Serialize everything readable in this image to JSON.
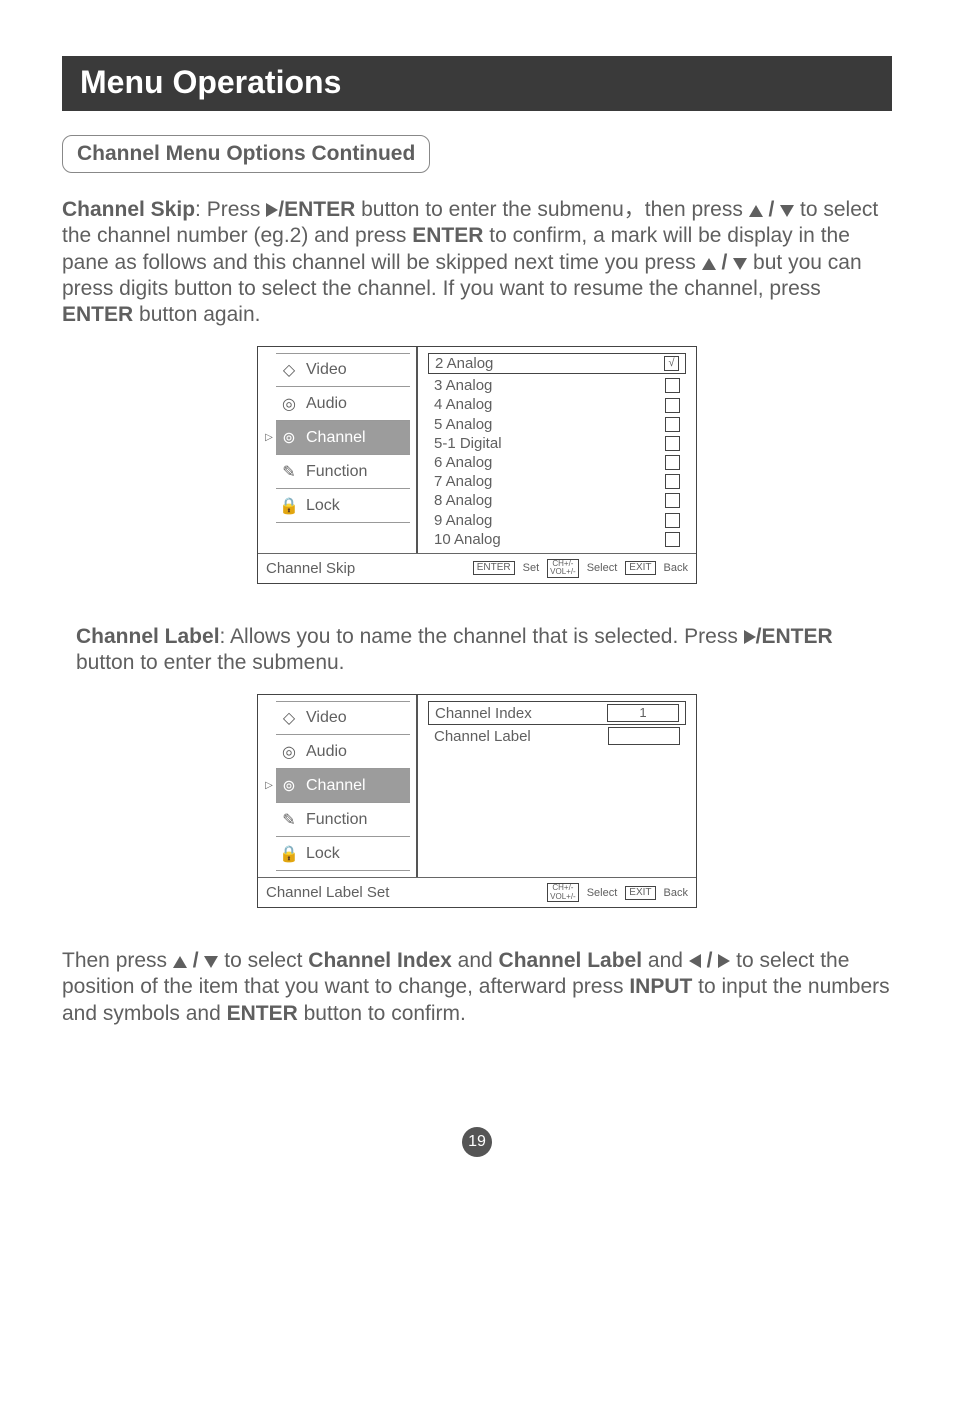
{
  "title": "Menu Operations",
  "subhead": "Channel Menu Options Continued",
  "para1": {
    "lead": "Channel Skip",
    "a": ": Press",
    "b": "/ENTER",
    "c": " button to enter the submenu，then press ",
    "sep": " / ",
    "d": " to select the channel number (eg.2) and press ",
    "enter1": "ENTER",
    "e": " to confirm, a mark will be display in the pane as follows and this channel will be skipped next time you press ",
    "f": " but you can press digits button to select the channel. If you want to resume the channel, press ",
    "enter2": "ENTER",
    "g": " button again."
  },
  "menu": {
    "items": [
      {
        "label": "Video",
        "icon": "◇"
      },
      {
        "label": "Audio",
        "icon": "◎"
      },
      {
        "label": "Channel",
        "icon": "⊚",
        "selected": true
      },
      {
        "label": "Function",
        "icon": "✎"
      },
      {
        "label": "Lock",
        "icon": "🔒"
      }
    ]
  },
  "skip_list": [
    {
      "name": "2 Analog",
      "checked": true,
      "selected": true
    },
    {
      "name": "3 Analog"
    },
    {
      "name": "4 Analog"
    },
    {
      "name": "5 Analog"
    },
    {
      "name": "5-1 Digital"
    },
    {
      "name": "6 Analog"
    },
    {
      "name": "7 Analog"
    },
    {
      "name": "8 Analog"
    },
    {
      "name": "9 Analog"
    },
    {
      "name": "10 Analog"
    }
  ],
  "footer1": {
    "name": "Channel Skip",
    "k1": "ENTER",
    "t1": "Set",
    "k2a": "CH+/-",
    "k2b": "VOL+/-",
    "t2": "Select",
    "k3": "EXIT",
    "t3": "Back"
  },
  "para2": {
    "lead": "Channel Label",
    "a": ": Allows you to name the channel that is selected. Press ",
    "b": "/ENTER",
    "c": " button to enter the submenu."
  },
  "label_panel": {
    "rows": [
      {
        "name": "Channel Index",
        "value": "1",
        "selected": true
      },
      {
        "name": "Channel Label",
        "value": ""
      }
    ]
  },
  "footer2": {
    "name": "Channel Label Set",
    "k2a": "CH+/-",
    "k2b": "VOL+/-",
    "t2": "Select",
    "k3": "EXIT",
    "t3": "Back"
  },
  "para3": {
    "a": "Then press ",
    "sep": " / ",
    "b": " to select ",
    "ci": "Channel Index",
    "and1": " and ",
    "cl": "Channel Label",
    "and2": " and ",
    "c": " to select the position of the item that you want to change, afterward press ",
    "input": "INPUT",
    "d": " to input the numbers and symbols and ",
    "enter": "ENTER",
    "e": " button to confirm."
  },
  "page_number": "19"
}
